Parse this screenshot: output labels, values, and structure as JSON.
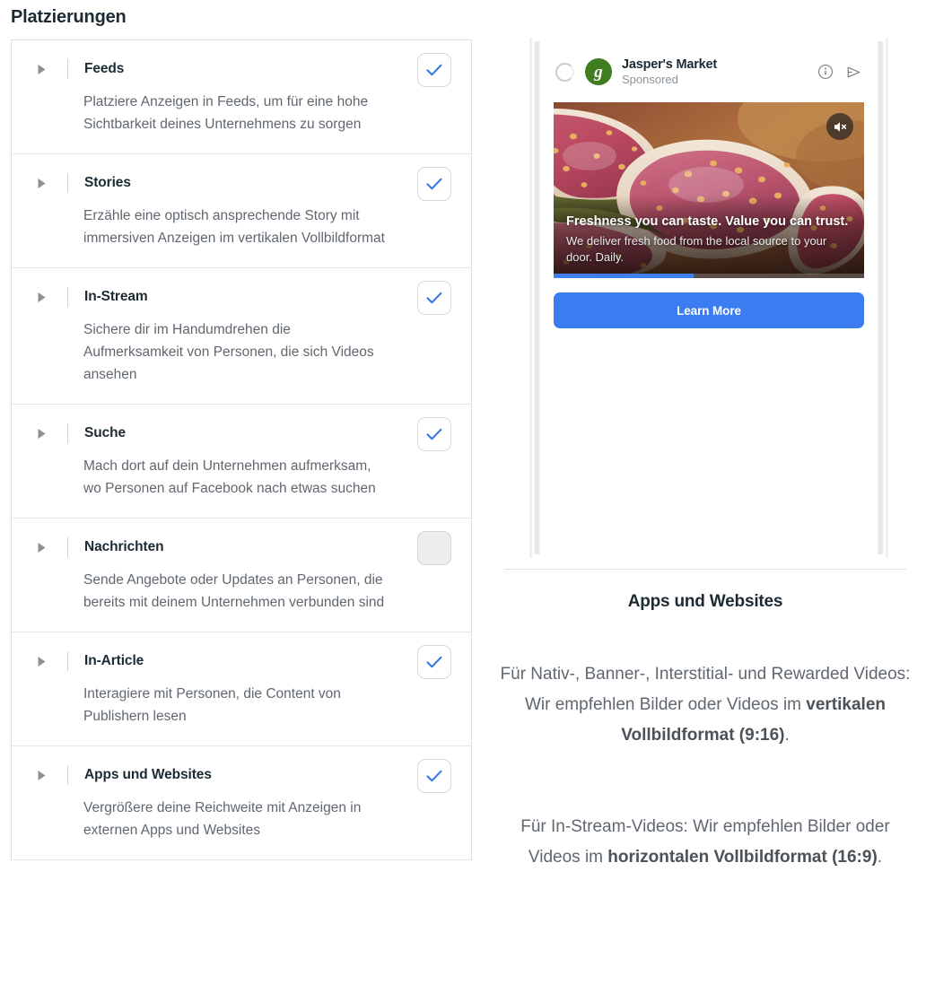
{
  "left_panel": {
    "title": "Platzierungen",
    "placements": [
      {
        "name": "Feeds",
        "description": "Platziere Anzeigen in Feeds, um für eine hohe Sichtbarkeit deines Unternehmens zu sorgen",
        "checked": true
      },
      {
        "name": "Stories",
        "description": "Erzähle eine optisch ansprechende Story mit immersiven Anzeigen im vertikalen Vollbildformat",
        "checked": true
      },
      {
        "name": "In-Stream",
        "description": "Sichere dir im Handumdrehen die Aufmerksamkeit von Personen, die sich Videos ansehen",
        "checked": true
      },
      {
        "name": "Suche",
        "description": "Mach dort auf dein Unternehmen aufmerksam, wo Personen auf Facebook nach etwas suchen",
        "checked": true
      },
      {
        "name": "Nachrichten",
        "description": "Sende Angebote oder Updates an Personen, die bereits mit deinem Unternehmen verbunden sind",
        "checked": false
      },
      {
        "name": "In-Article",
        "description": "Interagiere mit Personen, die Content von Publishern lesen",
        "checked": true
      },
      {
        "name": "Apps und Websites",
        "description": "Vergrößere deine Reichweite mit Anzeigen in externen Apps und Websites",
        "checked": true
      }
    ]
  },
  "preview": {
    "brand_name": "Jasper's Market",
    "brand_sublabel": "Sponsored",
    "brand_logo_glyph": "g",
    "icons": {
      "loading": "loading-spinner-icon",
      "info": "info-icon",
      "send": "send-play-icon",
      "mute": "mute-icon"
    },
    "ad_headline": "Freshness you can taste. Value you can trust.",
    "ad_body": "We deliver fresh food from the local source to your door. Daily.",
    "cta_label": "Learn More",
    "progress_percent": 45
  },
  "info_panel": {
    "title": "Apps und Websites",
    "paragraph_1": {
      "before": "Für Nativ-, Banner-, Interstitial- und Rewarded Videos: Wir empfehlen Bilder oder Videos im ",
      "bold": "vertikalen Vollbildformat (9:16)",
      "after": "."
    },
    "paragraph_2": {
      "before": "Für In-Stream-Videos: Wir empfehlen Bilder oder Videos im ",
      "bold": "horizontalen Vollbildformat (16:9)",
      "after": "."
    }
  },
  "colors": {
    "accent_blue": "#3b7cf0",
    "check_blue": "#3578e5",
    "brand_green": "#3f7d20",
    "text_dark": "#1c2b33",
    "text_muted": "#606770",
    "border": "#dddfe2"
  }
}
